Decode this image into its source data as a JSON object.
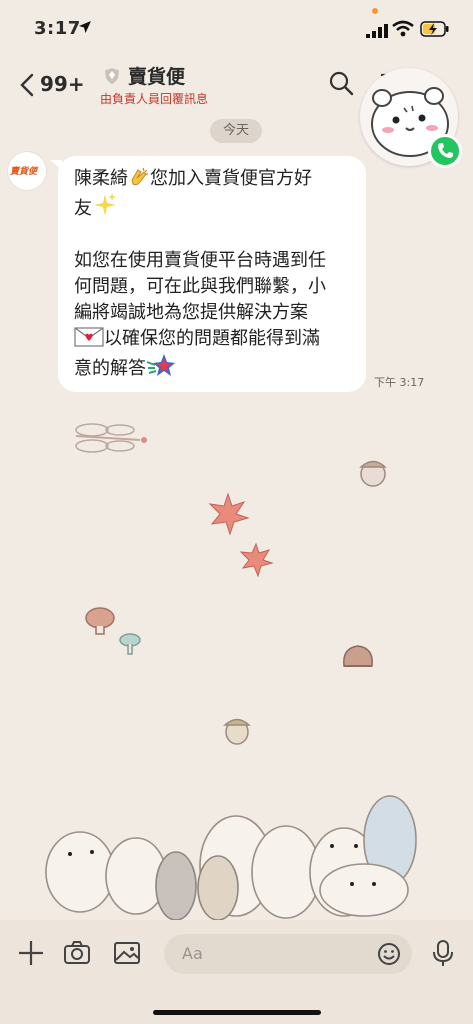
{
  "status_bar": {
    "time": "3:17"
  },
  "header": {
    "unread_count": "99+",
    "title": "賣貨便",
    "subtitle": "由負責人員回覆訊息"
  },
  "chat": {
    "date_separator": "今天",
    "avatar_logo_text": "賣貨便",
    "message": {
      "line1": "陳柔綺",
      "line1b": "您加入賣貨便官方好",
      "line2": "友",
      "para2": "如您在使用賣貨便平台時遇到任\n何問題，可在此與我們聯繫，小\n編將竭誠地為您提供解決方案",
      "line_mail": "以確保您的問題都能得到滿",
      "line_last": "意的解答",
      "time": "下午 3:17"
    }
  },
  "input_bar": {
    "placeholder": "Aa"
  },
  "colors": {
    "background": "#f2ebe3",
    "bubble": "#ffffff",
    "subtitle_red": "#c0392b",
    "call_green": "#22c55e"
  },
  "icons": [
    "location-arrow-icon",
    "signal-icon",
    "wifi-icon",
    "battery-icon",
    "back-chevron-icon",
    "shield-icon",
    "search-icon",
    "menu-icon",
    "phone-icon",
    "plus-icon",
    "camera-icon",
    "image-icon",
    "smile-icon",
    "mic-icon"
  ]
}
